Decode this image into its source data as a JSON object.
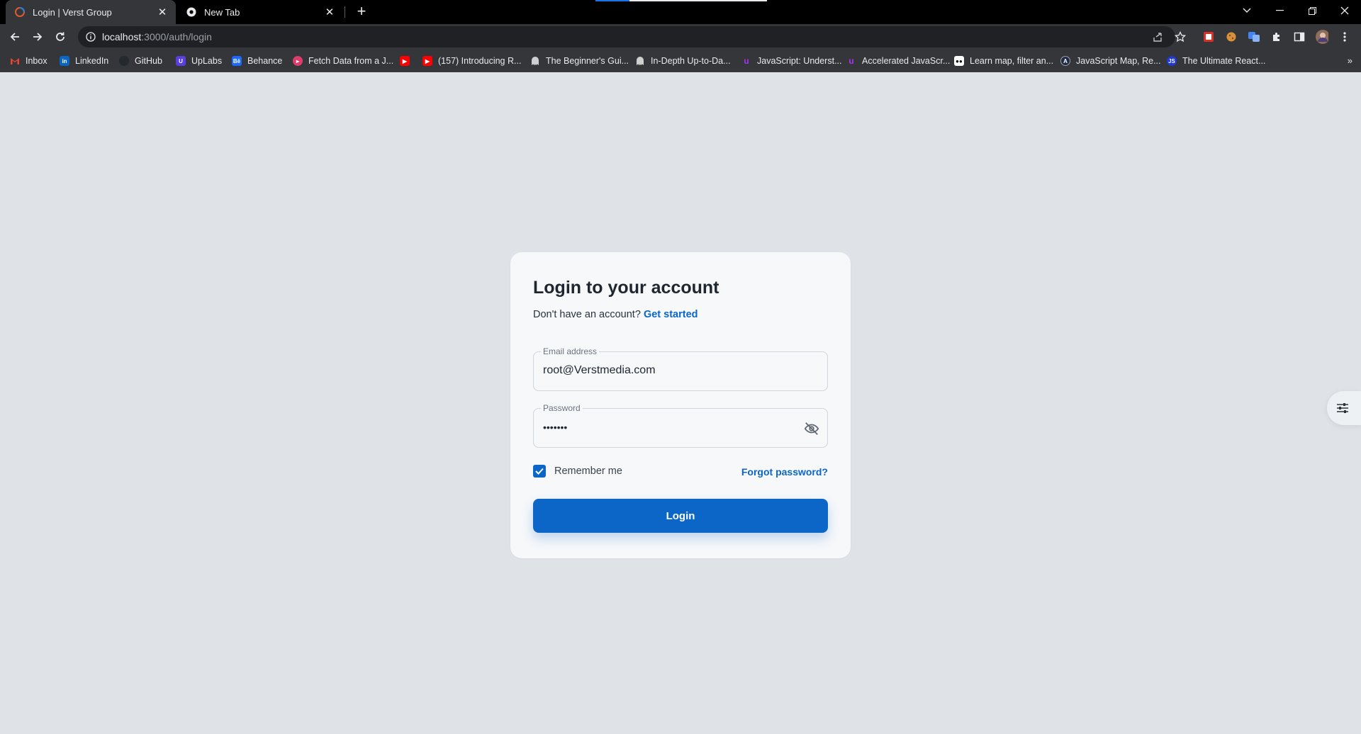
{
  "browser": {
    "tabs": [
      {
        "title": "Login | Verst Group",
        "active": true
      },
      {
        "title": "New Tab",
        "active": false
      }
    ],
    "address": {
      "host": "localhost",
      "path": ":3000/auth/login"
    },
    "bookmarks": [
      {
        "label": "Inbox",
        "icon": "gmail-icon",
        "color": "#ea4335"
      },
      {
        "label": "LinkedIn",
        "icon": "linkedin-icon",
        "color": "#0a66c2"
      },
      {
        "label": "GitHub",
        "icon": "github-icon",
        "color": "#24292f"
      },
      {
        "label": "UpLabs",
        "icon": "uplabs-icon",
        "color": "#5a3ee0"
      },
      {
        "label": "Behance",
        "icon": "behance-icon",
        "color": "#1769ff"
      },
      {
        "label": "Fetch Data from a J...",
        "icon": "site-icon",
        "color": "#e03c6b"
      },
      {
        "label": "",
        "icon": "youtube-icon",
        "color": "#ff0000"
      },
      {
        "label": "(157) Introducing R...",
        "icon": "youtube-icon",
        "color": "#ff0000"
      },
      {
        "label": "The Beginner's Gui...",
        "icon": "ghost-icon",
        "color": "#d0d0d0"
      },
      {
        "label": "In-Depth Up-to-Da...",
        "icon": "ghost-icon",
        "color": "#d0d0d0"
      },
      {
        "label": "JavaScript: Underst...",
        "icon": "udemy-icon",
        "color": "#a435f0"
      },
      {
        "label": "Accelerated JavaScr...",
        "icon": "udemy-icon",
        "color": "#a435f0"
      },
      {
        "label": "Learn map, filter an...",
        "icon": "medium-icon",
        "color": "#ffffff"
      },
      {
        "label": "JavaScript Map, Re...",
        "icon": "a-icon",
        "color": "#1f2a44"
      },
      {
        "label": "The Ultimate React...",
        "icon": "js-icon",
        "color": "#2038d8"
      }
    ]
  },
  "login": {
    "title": "Login to your account",
    "signup_prompt": "Don't have an account?",
    "signup_link": "Get started",
    "email_label": "Email address",
    "email_value": "root@Verstmedia.com",
    "password_label": "Password",
    "password_value": "•••••••",
    "remember_label": "Remember me",
    "remember_checked": true,
    "forgot_label": "Forgot password?",
    "submit_label": "Login"
  },
  "colors": {
    "accent": "#0b66c8",
    "page_bg": "#dfe3e8",
    "card_bg": "#f6f8fa"
  }
}
